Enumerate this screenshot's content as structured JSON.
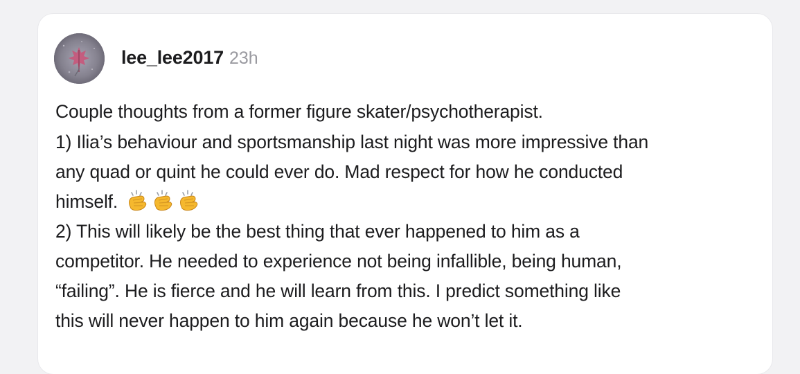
{
  "post": {
    "author": "lee_lee2017",
    "time": "23h",
    "avatar_icon": "maple-leaf-avatar",
    "paragraphs": {
      "p1": "Couple thoughts from a former figure skater/psychotherapist.",
      "p2_line1": "1) Ilia’s behaviour and sportsmanship last night was more impressive than",
      "p2_line2": "any quad or quint he could ever do. Mad respect for how he conducted",
      "p2_line3": "himself.",
      "p3_line1": "2) This will likely be the best thing that ever happened to him as a",
      "p3_line2": "competitor. He needed to experience not being infallible, being human,",
      "p3_line3": "“failing”. He is fierce and he will learn from this. I predict something like",
      "p3_line4": "this will never happen to him again because he won’t let it."
    },
    "emoji": {
      "name": "clapping-hands-icon",
      "count": 3,
      "color": "#f5b82e"
    }
  },
  "colors": {
    "background": "#f2f2f4",
    "card": "#ffffff",
    "text": "#1c1c1e",
    "muted": "#9a9aa0"
  }
}
